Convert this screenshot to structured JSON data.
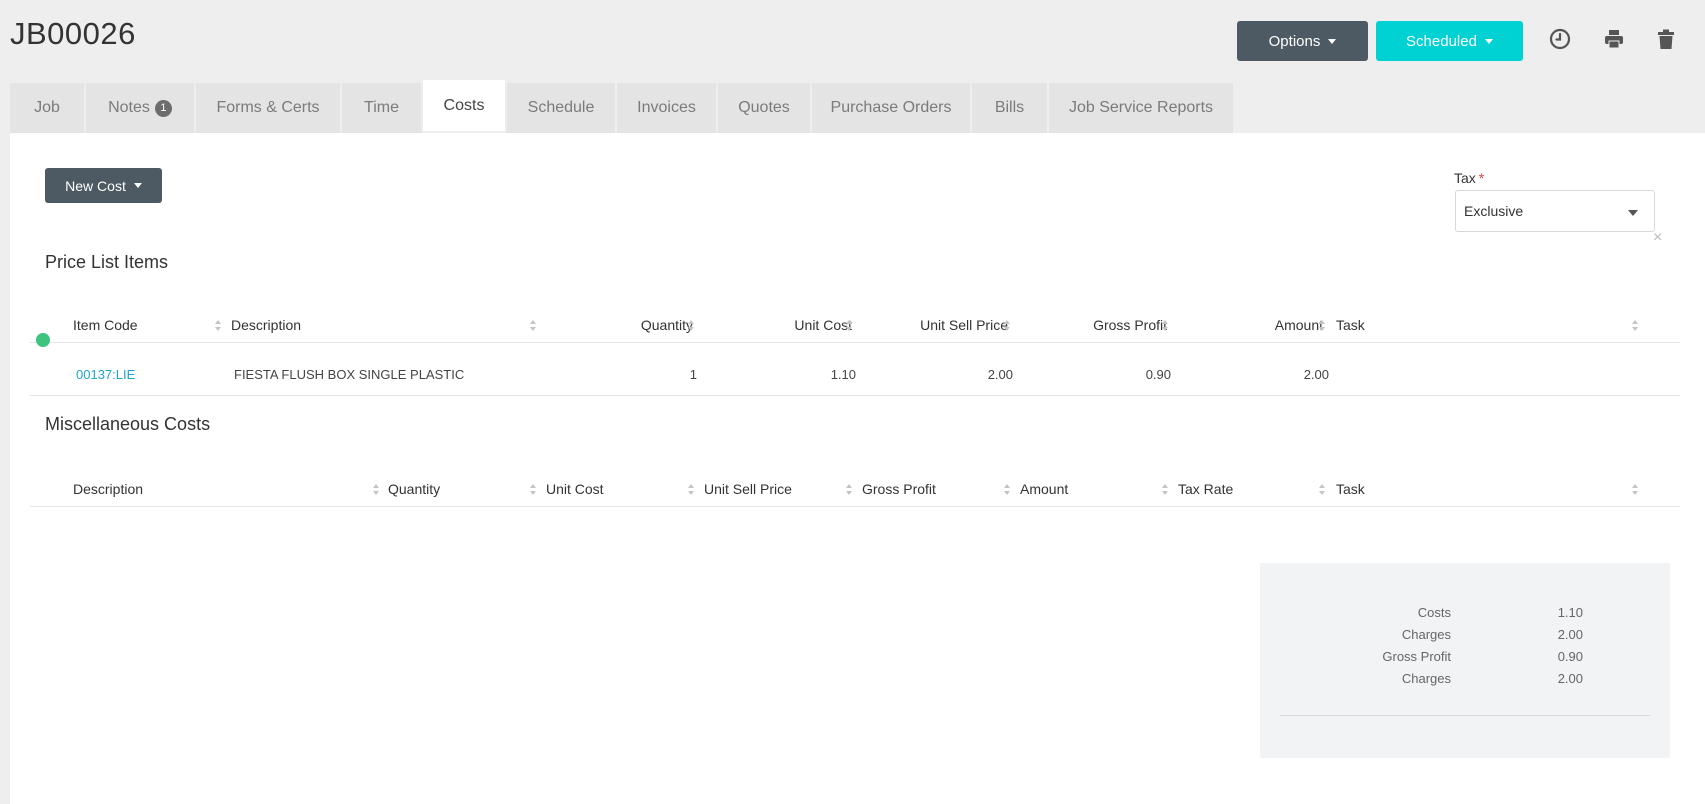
{
  "job_id": "JB00026",
  "actions": {
    "options_label": "Options",
    "status_label": "Scheduled",
    "status_color": "#00d2d4"
  },
  "icons": [
    "clock-icon",
    "print-icon",
    "trash-icon"
  ],
  "tabs": [
    {
      "label": "Job"
    },
    {
      "label": "Notes",
      "badge": "1"
    },
    {
      "label": "Forms & Certs"
    },
    {
      "label": "Time"
    },
    {
      "label": "Costs",
      "active": true
    },
    {
      "label": "Schedule"
    },
    {
      "label": "Invoices"
    },
    {
      "label": "Quotes"
    },
    {
      "label": "Purchase Orders"
    },
    {
      "label": "Bills"
    },
    {
      "label": "Job Service Reports"
    }
  ],
  "new_cost_label": "New Cost",
  "tax": {
    "label": "Tax",
    "required_mark": "*",
    "value": "Exclusive"
  },
  "price_list": {
    "title": "Price List Items",
    "columns": [
      "Item Code",
      "Description",
      "Quantity",
      "Unit Cost",
      "Unit Sell Price",
      "Gross Profit",
      "Amount",
      "Task"
    ],
    "rows": [
      {
        "item_code": "00137:LIE",
        "description": "FIESTA FLUSH BOX SINGLE PLASTIC",
        "quantity": "1",
        "unit_cost": "1.10",
        "unit_sell_price": "2.00",
        "gross_profit": "0.90",
        "amount": "2.00",
        "task": "",
        "remove": "×"
      }
    ]
  },
  "misc_costs": {
    "title": "Miscellaneous Costs",
    "columns": [
      "Description",
      "Quantity",
      "Unit Cost",
      "Unit Sell Price",
      "Gross Profit",
      "Amount",
      "Tax Rate",
      "Task"
    ]
  },
  "totals": [
    {
      "label": "Costs",
      "value": "1.10"
    },
    {
      "label": "Charges",
      "value": "2.00"
    },
    {
      "label": "Gross Profit",
      "value": "0.90"
    },
    {
      "label": "Charges",
      "value": "2.00"
    }
  ]
}
